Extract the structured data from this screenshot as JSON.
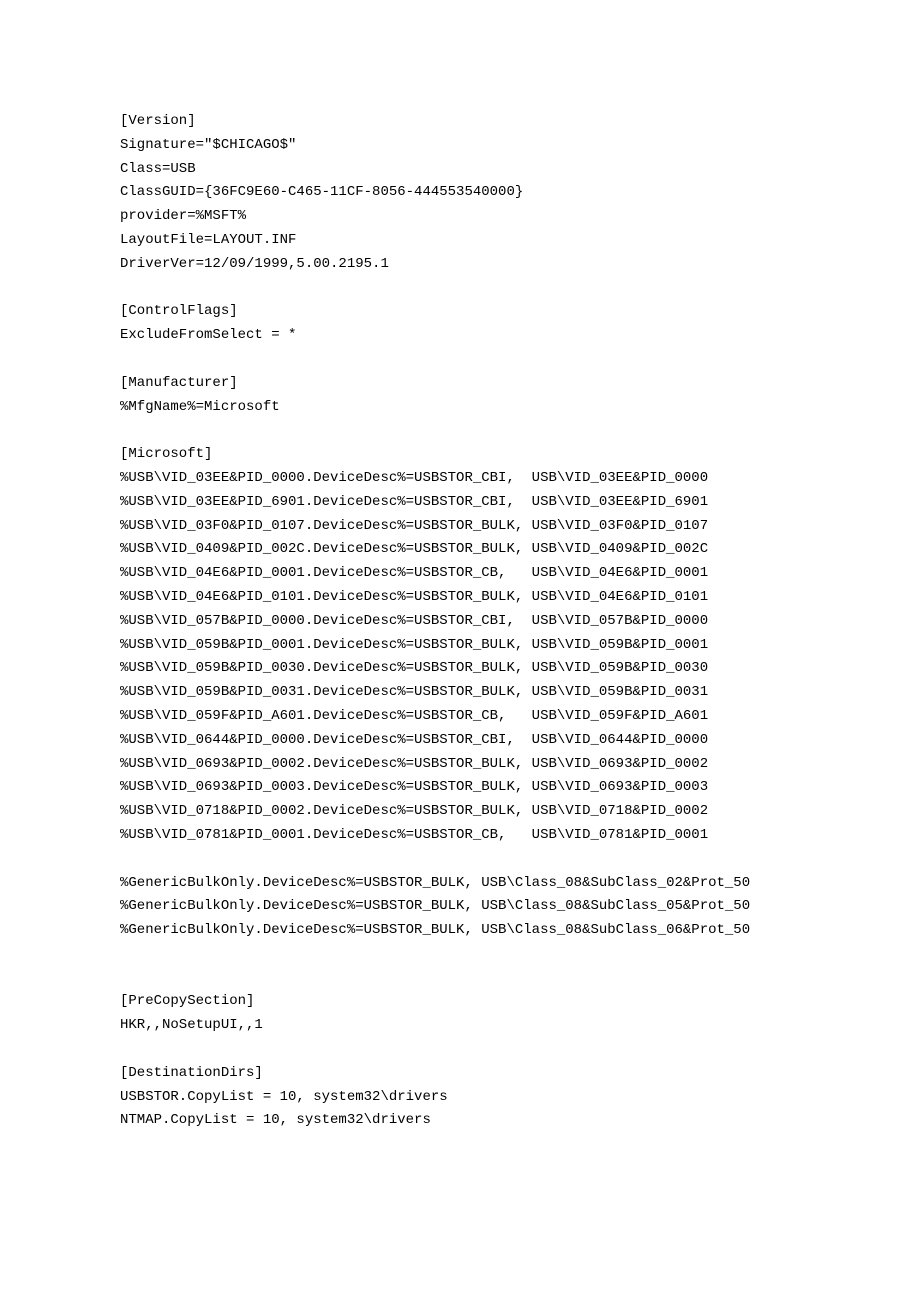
{
  "lines": [
    "[Version]",
    "Signature=\"$CHICAGO$\"",
    "Class=USB",
    "ClassGUID={36FC9E60-C465-11CF-8056-444553540000}",
    "provider=%MSFT%",
    "LayoutFile=LAYOUT.INF",
    "DriverVer=12/09/1999,5.00.2195.1",
    "",
    "[ControlFlags]",
    "ExcludeFromSelect = *",
    "",
    "[Manufacturer]",
    "%MfgName%=Microsoft",
    "",
    "[Microsoft]",
    "%USB\\VID_03EE&PID_0000.DeviceDesc%=USBSTOR_CBI,  USB\\VID_03EE&PID_0000",
    "%USB\\VID_03EE&PID_6901.DeviceDesc%=USBSTOR_CBI,  USB\\VID_03EE&PID_6901",
    "%USB\\VID_03F0&PID_0107.DeviceDesc%=USBSTOR_BULK, USB\\VID_03F0&PID_0107",
    "%USB\\VID_0409&PID_002C.DeviceDesc%=USBSTOR_BULK, USB\\VID_0409&PID_002C",
    "%USB\\VID_04E6&PID_0001.DeviceDesc%=USBSTOR_CB,   USB\\VID_04E6&PID_0001",
    "%USB\\VID_04E6&PID_0101.DeviceDesc%=USBSTOR_BULK, USB\\VID_04E6&PID_0101",
    "%USB\\VID_057B&PID_0000.DeviceDesc%=USBSTOR_CBI,  USB\\VID_057B&PID_0000",
    "%USB\\VID_059B&PID_0001.DeviceDesc%=USBSTOR_BULK, USB\\VID_059B&PID_0001",
    "%USB\\VID_059B&PID_0030.DeviceDesc%=USBSTOR_BULK, USB\\VID_059B&PID_0030",
    "%USB\\VID_059B&PID_0031.DeviceDesc%=USBSTOR_BULK, USB\\VID_059B&PID_0031",
    "%USB\\VID_059F&PID_A601.DeviceDesc%=USBSTOR_CB,   USB\\VID_059F&PID_A601",
    "%USB\\VID_0644&PID_0000.DeviceDesc%=USBSTOR_CBI,  USB\\VID_0644&PID_0000",
    "%USB\\VID_0693&PID_0002.DeviceDesc%=USBSTOR_BULK, USB\\VID_0693&PID_0002",
    "%USB\\VID_0693&PID_0003.DeviceDesc%=USBSTOR_BULK, USB\\VID_0693&PID_0003",
    "%USB\\VID_0718&PID_0002.DeviceDesc%=USBSTOR_BULK, USB\\VID_0718&PID_0002",
    "%USB\\VID_0781&PID_0001.DeviceDesc%=USBSTOR_CB,   USB\\VID_0781&PID_0001",
    "",
    "%GenericBulkOnly.DeviceDesc%=USBSTOR_BULK, USB\\Class_08&SubClass_02&Prot_50",
    "%GenericBulkOnly.DeviceDesc%=USBSTOR_BULK, USB\\Class_08&SubClass_05&Prot_50",
    "%GenericBulkOnly.DeviceDesc%=USBSTOR_BULK, USB\\Class_08&SubClass_06&Prot_50",
    "",
    "",
    "[PreCopySection]",
    "HKR,,NoSetupUI,,1",
    "",
    "[DestinationDirs]",
    "USBSTOR.CopyList = 10, system32\\drivers",
    "NTMAP.CopyList = 10, system32\\drivers"
  ]
}
